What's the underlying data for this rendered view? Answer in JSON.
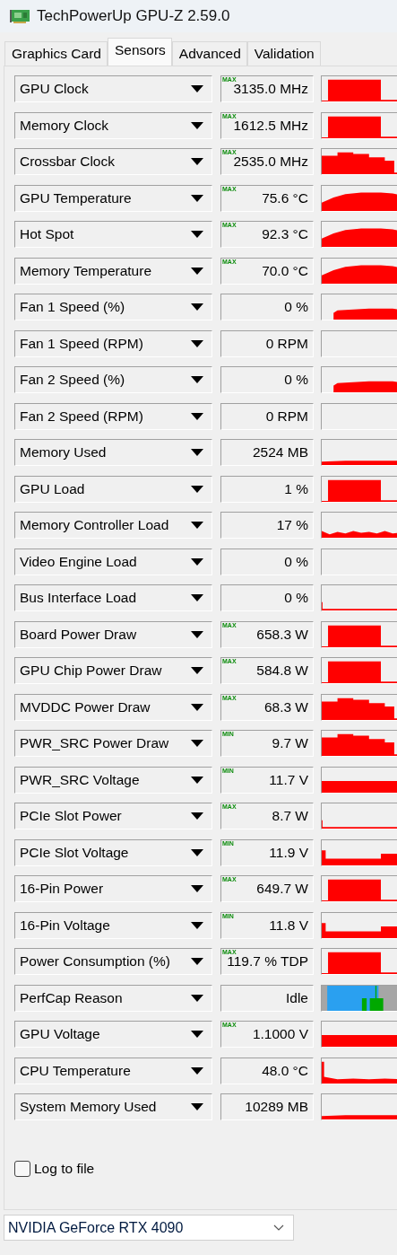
{
  "window": {
    "title": "TechPowerUp GPU-Z 2.59.0"
  },
  "tabs": [
    {
      "label": "Graphics Card",
      "selected": false
    },
    {
      "label": "Sensors",
      "selected": true
    },
    {
      "label": "Advanced",
      "selected": false
    },
    {
      "label": "Validation",
      "selected": false
    }
  ],
  "sensors": [
    {
      "name": "GPU Clock",
      "badge": "MAX",
      "value": "3135.0 MHz",
      "kind": "block"
    },
    {
      "name": "Memory Clock",
      "badge": "MAX",
      "value": "1612.5 MHz",
      "kind": "block"
    },
    {
      "name": "Crossbar Clock",
      "badge": "MAX",
      "value": "2535.0 MHz",
      "kind": "step"
    },
    {
      "name": "GPU Temperature",
      "badge": "MAX",
      "value": "75.6 °C",
      "kind": "rise"
    },
    {
      "name": "Hot Spot",
      "badge": "MAX",
      "value": "92.3 °C",
      "kind": "rise"
    },
    {
      "name": "Memory Temperature",
      "badge": "MAX",
      "value": "70.0 °C",
      "kind": "rise"
    },
    {
      "name": "Fan 1 Speed (%)",
      "value": "0 %",
      "kind": "low"
    },
    {
      "name": "Fan 1 Speed (RPM)",
      "value": "0 RPM",
      "kind": "none"
    },
    {
      "name": "Fan 2 Speed (%)",
      "value": "0 %",
      "kind": "low"
    },
    {
      "name": "Fan 2 Speed (RPM)",
      "value": "0 RPM",
      "kind": "none"
    },
    {
      "name": "Memory Used",
      "value": "2524 MB",
      "kind": "baseline"
    },
    {
      "name": "GPU Load",
      "value": "1 %",
      "kind": "block"
    },
    {
      "name": "Memory Controller Load",
      "value": "17 %",
      "kind": "noise"
    },
    {
      "name": "Video Engine Load",
      "value": "0 %",
      "kind": "none"
    },
    {
      "name": "Bus Interface Load",
      "value": "0 %",
      "kind": "thin"
    },
    {
      "name": "Board Power Draw",
      "badge": "MAX",
      "value": "658.3 W",
      "kind": "block"
    },
    {
      "name": "GPU Chip Power Draw",
      "badge": "MAX",
      "value": "584.8 W",
      "kind": "block"
    },
    {
      "name": "MVDDC Power Draw",
      "badge": "MAX",
      "value": "68.3 W",
      "kind": "step"
    },
    {
      "name": "PWR_SRC Power Draw",
      "badge": "MIN",
      "value": "9.7 W",
      "kind": "step"
    },
    {
      "name": "PWR_SRC Voltage",
      "badge": "MIN",
      "value": "11.7 V",
      "kind": "wide"
    },
    {
      "name": "PCIe Slot Power",
      "badge": "MAX",
      "value": "8.7 W",
      "kind": "thin"
    },
    {
      "name": "PCIe Slot Voltage",
      "badge": "MIN",
      "value": "11.9 V",
      "kind": "dip"
    },
    {
      "name": "16-Pin Power",
      "badge": "MAX",
      "value": "649.7 W",
      "kind": "block"
    },
    {
      "name": "16-Pin Voltage",
      "badge": "MIN",
      "value": "11.8 V",
      "kind": "dip"
    },
    {
      "name": "Power Consumption (%)",
      "badge": "MAX",
      "value": "119.7 % TDP",
      "kind": "block"
    },
    {
      "name": "PerfCap Reason",
      "value": "Idle",
      "kind": "perfcap"
    },
    {
      "name": "GPU Voltage",
      "badge": "MAX",
      "value": "1.1000 V",
      "kind": "wide"
    },
    {
      "name": "CPU Temperature",
      "value": "48.0 °C",
      "kind": "spike"
    },
    {
      "name": "System Memory Used",
      "value": "10289 MB",
      "kind": "baseline"
    }
  ],
  "log_to_file": {
    "label": "Log to file",
    "checked": false
  },
  "gpu_select": {
    "value": "NVIDIA GeForce RTX 4090"
  }
}
